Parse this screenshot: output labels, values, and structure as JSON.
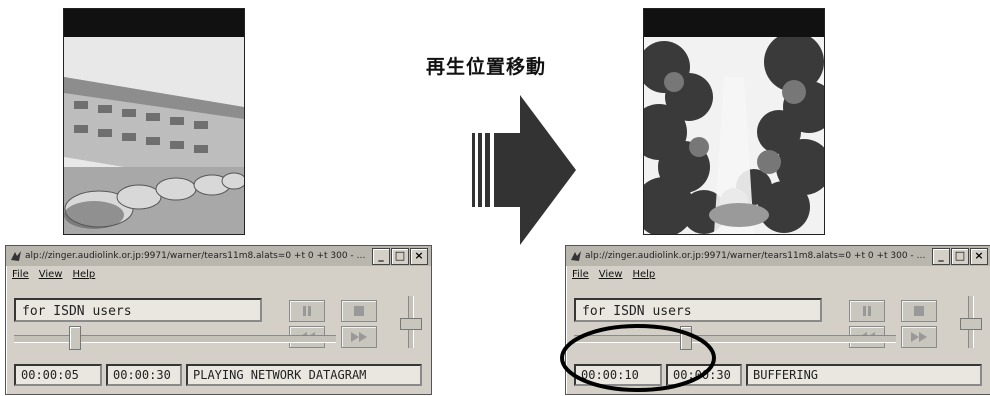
{
  "caption": "再生位置移動",
  "players": [
    {
      "title": "alp://zinger.audiolink.or.jp:9971/warner/tears11m8.alats=0 +t 0 +t 300 - AudioL",
      "menu": [
        "File",
        "View",
        "Help"
      ],
      "clip_title": "for ISDN users",
      "current_time": "00:00:05",
      "total_time": "00:00:30",
      "status": "PLAYING NETWORK DATAGRAM",
      "seek_position_fraction": 0.17,
      "window_buttons": [
        "_",
        "□",
        "×"
      ]
    },
    {
      "title": "alp://zinger.audiolink.or.jp:9971/warner/tears11m8.alats=0 +t 0 +t 300 - AudioL",
      "menu": [
        "File",
        "View",
        "Help"
      ],
      "clip_title": "for ISDN users",
      "current_time": "00:00:10",
      "total_time": "00:00:30",
      "status": "BUFFERING",
      "seek_position_fraction": 0.33,
      "window_buttons": [
        "_",
        "□",
        "×"
      ]
    }
  ],
  "frames": {
    "left": {
      "icon": "building-scene"
    },
    "right": {
      "icon": "trees-scene"
    }
  },
  "colors": {
    "window": "#d4d0c8",
    "titlebar": "#b9b6ae",
    "ring": "#000000"
  }
}
